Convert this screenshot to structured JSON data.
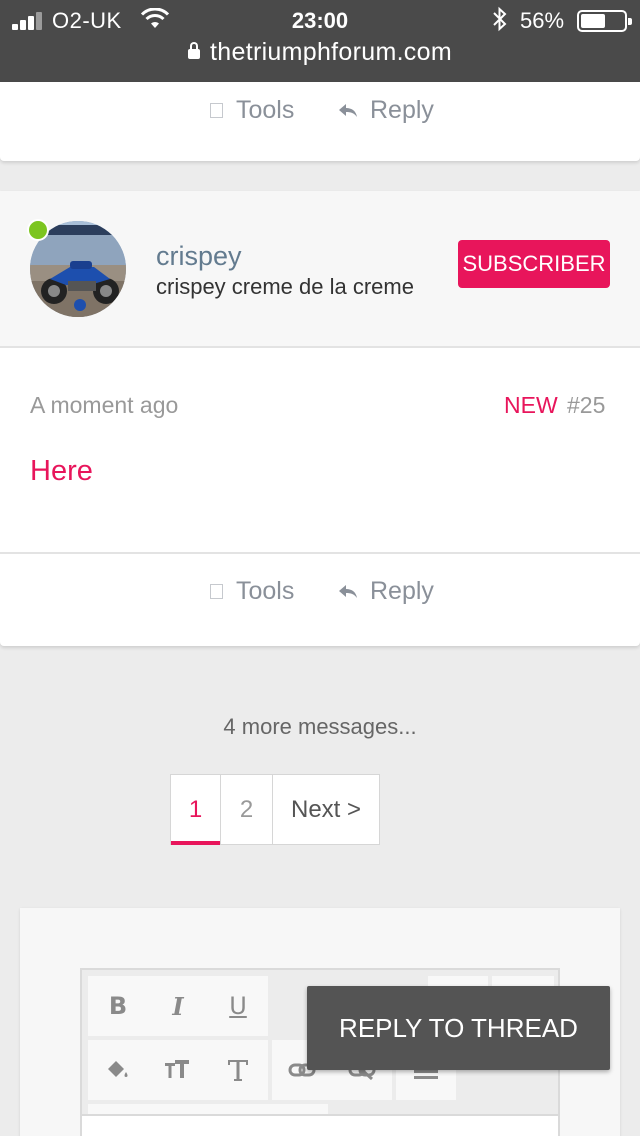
{
  "status_bar": {
    "carrier": "O2-UK",
    "time": "23:00",
    "battery_percent": "56%",
    "battery_level": 0.56,
    "url": "thetriumphforum.com"
  },
  "prev_post_actions": {
    "tools_label": "Tools",
    "reply_label": "Reply"
  },
  "post": {
    "username": "crispey",
    "user_title": "crispey creme de la creme",
    "badge": "SUBSCRIBER",
    "time": "A moment ago",
    "new_label": "NEW",
    "number": "#25",
    "body": "Here",
    "tools_label": "Tools",
    "reply_label": "Reply",
    "online": true
  },
  "thread": {
    "more_messages": "4 more messages..."
  },
  "pagination": {
    "pages": [
      "1",
      "2"
    ],
    "current": "1",
    "next_label": "Next >"
  },
  "editor": {
    "toolbar_row1": [
      "B",
      "I",
      "U"
    ],
    "toolbar_row2_icons": [
      "paint-bucket-icon",
      "text-size-icon",
      "text-style-icon",
      "link-icon",
      "unlink-icon",
      "align-icon"
    ],
    "reply_to_thread_label": "REPLY TO THREAD"
  },
  "colors": {
    "accent": "#e8155b",
    "status_bar": "#4a4a4a",
    "online": "#7cc520"
  }
}
